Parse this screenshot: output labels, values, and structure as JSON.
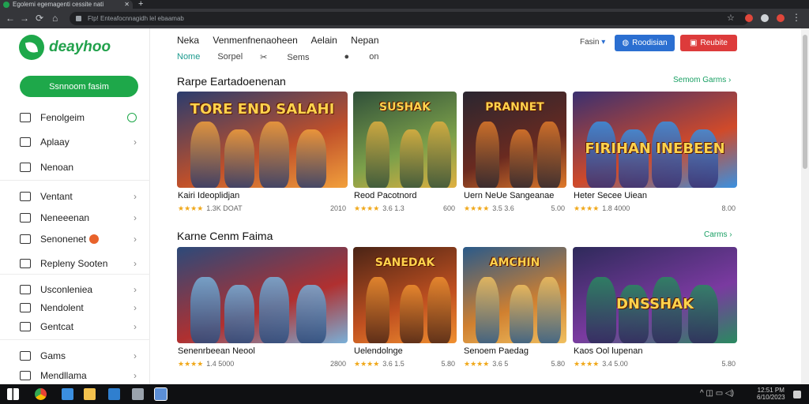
{
  "browser": {
    "tab_title": "Egolemi egemagenti cessite nati",
    "new_tab": "+",
    "close": "✕",
    "back": "←",
    "forward": "→",
    "reload": "⟳",
    "home": "⌂",
    "url": "Ftp! Enteafocnnagidh lel ebaamab",
    "star": "☆",
    "menu": "⋮"
  },
  "logo": {
    "text": "deayhoo"
  },
  "sidebar": {
    "cta": "Ssnnoom fasim",
    "group1": [
      {
        "label": "Fenolgeim",
        "trail": "dot"
      },
      {
        "label": "Aplaay",
        "trail": "chev"
      },
      {
        "label": "Nenoan",
        "trail": ""
      }
    ],
    "group2": [
      {
        "label": "Ventant",
        "trail": "chev"
      },
      {
        "label": "Neneeenan",
        "trail": "chev"
      },
      {
        "label": "Senonenet",
        "trail": "chev",
        "badge": true
      },
      {
        "label": "Repleny Sooten",
        "trail": "chev"
      }
    ],
    "group3": [
      {
        "label": "Usconleniea",
        "trail": "chev"
      },
      {
        "label": "Nendolent",
        "trail": "chev"
      },
      {
        "label": "Gentcat",
        "trail": "chev"
      }
    ],
    "group4": [
      {
        "label": "Gams",
        "trail": "chev"
      },
      {
        "label": "Mendllama",
        "trail": "chev"
      }
    ]
  },
  "topnav": [
    "Neka",
    "Venmenfnenaoheen",
    "Aelain",
    "Nepan"
  ],
  "subnav": {
    "active": "Nome",
    "items": [
      "Sorpel",
      "Sems",
      "on"
    ]
  },
  "header": {
    "language": "Fasin",
    "blue_button": "Roodisian",
    "red_button": "Reubite"
  },
  "section1": {
    "title": "Rarpe Eartadoenenan",
    "link": "Semom Garms",
    "cards": [
      {
        "title": "Kairi Ideoplidjan",
        "art": "TORE END SALAHI",
        "rating": "★★★★",
        "count": "1.3K DOAT",
        "price": "2010"
      },
      {
        "title": "Reod Pacotnord",
        "art": "SUSHAK",
        "rating": "★★★★",
        "count": "3.6 1.3",
        "price": "600"
      },
      {
        "title": "Uern NeUe Sangeanae",
        "art": "PRANNET",
        "rating": "★★★★",
        "count": "3.5 3.6",
        "price": "5.00"
      },
      {
        "title": "Heter Secee Uiean",
        "art": "FIRIHAN INEBEEN",
        "rating": "★★★★",
        "count": "1.8 4000",
        "price": "8.00"
      }
    ]
  },
  "section2": {
    "title": "Karne Cenm Faima",
    "link": "Carms",
    "cards": [
      {
        "title": "Senenrbeean Neool",
        "art": "",
        "rating": "★★★★",
        "count": "1.4 5000",
        "price": "2800"
      },
      {
        "title": "Uelendolnge",
        "art": "SANEDAK",
        "rating": "★★★★",
        "count": "3.6 1.5",
        "price": "5.80"
      },
      {
        "title": "Senoem Paedag",
        "art": "AMCHIN",
        "rating": "★★★★",
        "count": "3.6 5",
        "price": "5.80"
      },
      {
        "title": "Kaos Ool lupenan",
        "art": "DNSSHAK",
        "rating": "★★★★",
        "count": "3.4 5.00",
        "price": "5.80"
      }
    ]
  },
  "taskbar": {
    "tray": "^ ◫ ▭ ◁)",
    "clock_time": "12:51 PM",
    "clock_date": "6/10/2023"
  },
  "colors": {
    "accent_green": "#1ea84a",
    "blue": "#2b6fd1",
    "red": "#dd3b3b",
    "teal": "#1c9a8e"
  }
}
